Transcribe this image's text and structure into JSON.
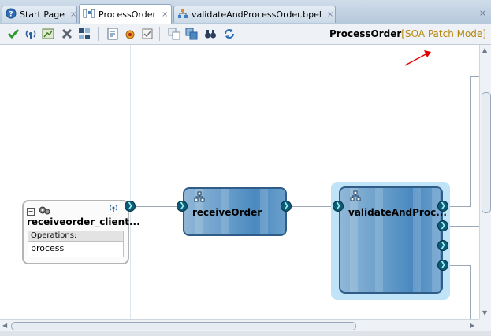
{
  "tabs": [
    {
      "label": "Start Page",
      "icon": "help-icon"
    },
    {
      "label": "ProcessOrder",
      "icon": "composite-icon",
      "active": true
    },
    {
      "label": "validateAndProcessOrder.bpel",
      "icon": "bpel-icon"
    }
  ],
  "tab_close_glyph": "×",
  "tabbar_close_glyph": "×",
  "toolbar": {
    "composite_name": "ProcessOrder",
    "mode": "[SOA Patch Mode]",
    "buttons": [
      "validate-icon",
      "wsdl-icon",
      "chart-icon",
      "delete-icon",
      "layout-icon",
      "xsd-icon",
      "bug-icon",
      "checklist-icon",
      "copy-icon",
      "paste-icon",
      "binoculars-icon",
      "refresh-icon"
    ]
  },
  "service": {
    "name": "receiveorder_client...",
    "operations_label": "Operations:",
    "operation": "process",
    "collapse_glyph": "−"
  },
  "components": [
    {
      "name": "receiveOrder"
    },
    {
      "name": "validateAndProc..."
    }
  ],
  "colors": {
    "accent": "#0d5b78",
    "mode": "#b8860b",
    "annotation": "#dd0000"
  }
}
